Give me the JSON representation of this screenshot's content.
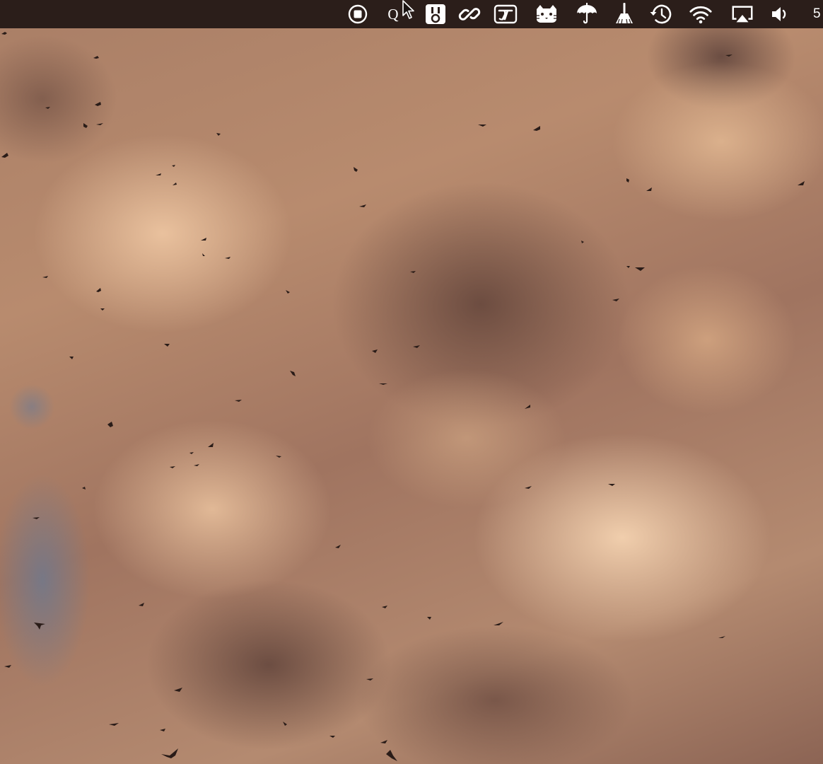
{
  "screen": {
    "wallpaper": "cloudy-sky-with-birds",
    "wallpaper_colors": {
      "light": "#f0cfae",
      "mid": "#b48a70",
      "dark": "#5e4238",
      "blue_patch": "#7a8296"
    }
  },
  "menubar": {
    "background": "#2b1e1a",
    "foreground": "#ffffff",
    "items": [
      {
        "name": "screen-record-stop-icon",
        "label": ""
      },
      {
        "name": "quick-text-icon",
        "label": "Q"
      },
      {
        "name": "bartender-icon",
        "label": ""
      },
      {
        "name": "link-icon",
        "label": ""
      },
      {
        "name": "typinator-icon",
        "label": ""
      },
      {
        "name": "cat-icon",
        "label": ""
      },
      {
        "name": "umbrella-icon",
        "label": ""
      },
      {
        "name": "broom-icon",
        "label": ""
      },
      {
        "name": "time-machine-icon",
        "label": ""
      },
      {
        "name": "wifi-icon",
        "label": ""
      },
      {
        "name": "airplay-icon",
        "label": ""
      },
      {
        "name": "volume-icon",
        "label": ""
      }
    ],
    "clock_partial": "5"
  },
  "cursor": {
    "name": "arrow-cursor-icon"
  }
}
